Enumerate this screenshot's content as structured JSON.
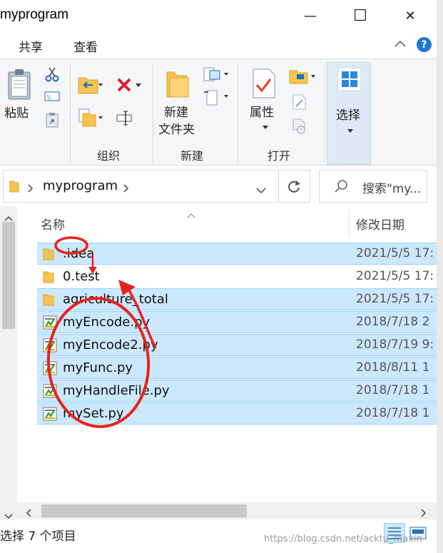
{
  "window": {
    "title": "myprogram",
    "minimize": "—",
    "maximize": "☐",
    "close": "✕"
  },
  "tabs": [
    {
      "label": "共享"
    },
    {
      "label": "查看"
    }
  ],
  "ribbon": {
    "paste": "粘贴",
    "group_organize": "组织",
    "new_folder_line1": "新建",
    "new_folder_line2": "文件夹",
    "group_new": "新建",
    "properties": "属性",
    "group_open": "打开",
    "select": "选择"
  },
  "address": {
    "path": "myprogram",
    "search_placeholder": "搜索\"my..."
  },
  "columns": {
    "name": "名称",
    "modified": "修改日期"
  },
  "files": [
    {
      "name": ".idea",
      "date": "2021/5/5 17:",
      "type": "folder",
      "selected": true
    },
    {
      "name": "0.test",
      "date": "2021/5/5 17:",
      "type": "folder",
      "selected": false
    },
    {
      "name": "agriculture_total",
      "date": "2021/5/5 17:",
      "type": "folder",
      "selected": true
    },
    {
      "name": "myEncode.py",
      "date": "2018/7/18 2",
      "type": "py",
      "selected": true
    },
    {
      "name": "myEncode2.py",
      "date": "2018/7/19 9:",
      "type": "py",
      "selected": true
    },
    {
      "name": "myFunc.py",
      "date": "2018/8/11 1",
      "type": "py",
      "selected": true
    },
    {
      "name": "myHandleFile.py",
      "date": "2018/7/18 1",
      "type": "py",
      "selected": true
    },
    {
      "name": "mySet.py",
      "date": "2018/7/18 1",
      "type": "py",
      "selected": true
    }
  ],
  "status": {
    "text": "选择 7 个项目"
  },
  "watermark": "https://blog.csdn.net/acktu_maxin",
  "colors": {
    "selection": "#cce8ff",
    "selection_border": "#99d1ff",
    "folder": "#f8c44f",
    "annotation": "#e8231a",
    "accent": "#1f77d0"
  }
}
